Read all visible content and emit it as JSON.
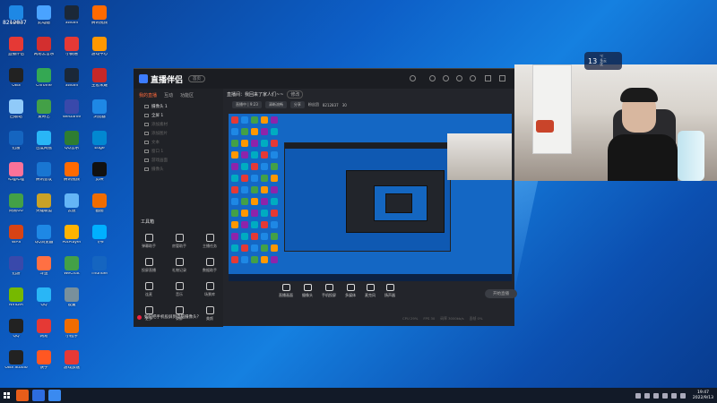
{
  "desktop": {
    "top_left_number": "8212837",
    "icons": [
      {
        "label": "ToDesk",
        "color": "#1e88e5",
        "col": 0,
        "row": 0
      },
      {
        "label": "此电脑",
        "color": "#4aa3ff",
        "col": 1,
        "row": 0
      },
      {
        "label": "Steam",
        "color": "#1b2838",
        "col": 2,
        "row": 0
      },
      {
        "label": "腾讯视频",
        "color": "#ff6a00",
        "col": 3,
        "row": 0
      },
      {
        "label": "直播伴侣",
        "color": "#e53935",
        "col": 0,
        "row": 1
      },
      {
        "label": "网易云音乐",
        "color": "#d32f2f",
        "col": 1,
        "row": 1
      },
      {
        "label": "小鹅通",
        "color": "#e53935",
        "col": 2,
        "row": 1
      },
      {
        "label": "游戏中心",
        "color": "#ff9800",
        "col": 3,
        "row": 1
      },
      {
        "label": "OBS",
        "color": "#222",
        "col": 0,
        "row": 2
      },
      {
        "label": "Chrome",
        "color": "#34a853",
        "col": 1,
        "row": 2
      },
      {
        "label": "Steam",
        "color": "#1b2838",
        "col": 2,
        "row": 2
      },
      {
        "label": "王者荣耀",
        "color": "#c62828",
        "col": 3,
        "row": 2
      },
      {
        "label": "回收站",
        "color": "#90caf9",
        "col": 0,
        "row": 3
      },
      {
        "label": "爱奇艺",
        "color": "#43a047",
        "col": 1,
        "row": 3
      },
      {
        "label": "WeGame",
        "color": "#3949ab",
        "col": 2,
        "row": 3
      },
      {
        "label": "浏览器",
        "color": "#1e88e5",
        "col": 3,
        "row": 3
      },
      {
        "label": "迅雷",
        "color": "#1565c0",
        "col": 0,
        "row": 4
      },
      {
        "label": "百度网盘",
        "color": "#29b6f6",
        "col": 1,
        "row": 4
      },
      {
        "label": "QQ音乐",
        "color": "#2e7d32",
        "col": 2,
        "row": 4
      },
      {
        "label": "Edge",
        "color": "#0288d1",
        "col": 3,
        "row": 4
      },
      {
        "label": "哔哩哔哩",
        "color": "#fb7299",
        "col": 0,
        "row": 5
      },
      {
        "label": "腾讯会议",
        "color": "#1976d2",
        "col": 1,
        "row": 5
      },
      {
        "label": "腾讯视频",
        "color": "#ff6a00",
        "col": 2,
        "row": 5
      },
      {
        "label": "剪映",
        "color": "#111",
        "col": 3,
        "row": 5
      },
      {
        "label": "网易UU",
        "color": "#43a047",
        "col": 0,
        "row": 6
      },
      {
        "label": "英雄联盟",
        "color": "#c9a227",
        "col": 1,
        "row": 6
      },
      {
        "label": "云盘",
        "color": "#64b5f6",
        "col": 2,
        "row": 6
      },
      {
        "label": "画图",
        "color": "#ef6c00",
        "col": 3,
        "row": 6
      },
      {
        "label": "WPS",
        "color": "#d84315",
        "col": 0,
        "row": 7
      },
      {
        "label": "QQ浏览器",
        "color": "#1e88e5",
        "col": 1,
        "row": 7
      },
      {
        "label": "PotPlayer",
        "color": "#ffb300",
        "col": 2,
        "row": 7
      },
      {
        "label": "飞书",
        "color": "#00b0ff",
        "col": 3,
        "row": 7
      },
      {
        "label": "迅游",
        "color": "#3949ab",
        "col": 0,
        "row": 8
      },
      {
        "label": "斗鱼",
        "color": "#ff7043",
        "col": 1,
        "row": 8
      },
      {
        "label": "WeChat",
        "color": "#43a047",
        "col": 2,
        "row": 8
      },
      {
        "label": "Thunder",
        "color": "#1565c0",
        "col": 3,
        "row": 8
      },
      {
        "label": "NVIDIA",
        "color": "#76b900",
        "col": 0,
        "row": 9
      },
      {
        "label": "QQ",
        "color": "#29b6f6",
        "col": 1,
        "row": 9
      },
      {
        "label": "设置",
        "color": "#78909c",
        "col": 2,
        "row": 9
      },
      {
        "label": "QQ",
        "color": "#222",
        "col": 0,
        "row": 10
      },
      {
        "label": "网易",
        "color": "#e53935",
        "col": 1,
        "row": 10
      },
      {
        "label": "小程序",
        "color": "#ef6c00",
        "col": 2,
        "row": 10
      },
      {
        "label": "OBS Studio",
        "color": "#222",
        "col": 0,
        "row": 11
      },
      {
        "label": "快手",
        "color": "#ff5722",
        "col": 1,
        "row": 11
      },
      {
        "label": "游戏加速",
        "color": "#e53935",
        "col": 2,
        "row": 11
      }
    ]
  },
  "app": {
    "logo_text": "直播伴侣",
    "header_pill": "首页",
    "tabs": [
      "我的直播",
      "互动",
      "功能区"
    ],
    "scenes": [
      {
        "label": "摄像头 1",
        "dim": false
      },
      {
        "label": "全屏 1",
        "dim": false
      },
      {
        "label": "添加素材",
        "dim": true
      },
      {
        "label": "添加图片",
        "dim": true
      },
      {
        "label": "文本",
        "dim": true
      },
      {
        "label": "窗口 1",
        "dim": true
      },
      {
        "label": "游戏画面",
        "dim": true
      },
      {
        "label": "摄像头",
        "dim": true
      }
    ],
    "toolbox_title": "工具箱",
    "tools": [
      {
        "label": "弹幕助手"
      },
      {
        "label": "房管助手"
      },
      {
        "label": "主播任务"
      },
      {
        "label": "投屏直播"
      },
      {
        "label": "礼物记录"
      },
      {
        "label": "数据助手"
      },
      {
        "label": "连麦"
      },
      {
        "label": "音乐"
      },
      {
        "label": "场景库"
      },
      {
        "label": "更多"
      },
      {
        "label": "录屏"
      },
      {
        "label": "美颜"
      }
    ],
    "tip_text": "如何把手机投屏到电脑摄像头？",
    "title": "直播间：我回来了家人们~~",
    "title_edit": "修改",
    "subbar": [
      "直播中 | 9:23",
      "清晰流畅",
      "分享",
      "粉丝团",
      "8212837",
      "30"
    ],
    "bottom_buttons": [
      {
        "label": "直播画面"
      },
      {
        "label": "摄像头"
      },
      {
        "label": "手机投屏"
      },
      {
        "label": "多媒体"
      },
      {
        "label": "麦克风"
      },
      {
        "label": "扬声器"
      }
    ],
    "start_button": "开始直播",
    "status_line": [
      "CPU 29%",
      "FPS 30",
      "码率 3000kb/s",
      "丢帧 0%"
    ]
  },
  "weather": {
    "temp": "13",
    "unit": "℃",
    "desc": "多云",
    "aqi": "优"
  },
  "taskbar": {
    "time": "19:47",
    "date": "2022/9/13"
  }
}
